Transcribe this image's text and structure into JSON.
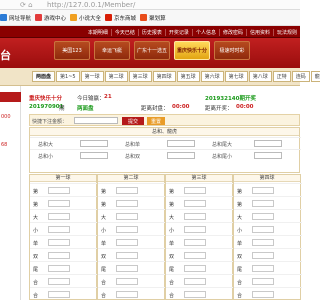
{
  "browser": {
    "url": "http://127.0.0.1/Member/",
    "bookmarks": [
      {
        "label": "网址导航",
        "color": "#2b7bd6"
      },
      {
        "label": "游戏中心",
        "color": "#e23b3b"
      },
      {
        "label": "小说大全",
        "color": "#f0a020"
      },
      {
        "label": "京东商城",
        "color": "#d81e06"
      },
      {
        "label": "聚划算",
        "color": "#e94d1b"
      }
    ]
  },
  "topbar": {
    "links": [
      "本期明细",
      "今天已结",
      "历史报表",
      "开奖记录",
      "个人信息",
      "修改密码",
      "信用资料",
      "玩法规则"
    ]
  },
  "header": {
    "logo": "台",
    "tabs": [
      {
        "label": "美国123",
        "active": false
      },
      {
        "label": "幸运飞艇",
        "active": false
      },
      {
        "label": "广东十一选五",
        "active": false
      },
      {
        "label": "重庆快乐十分",
        "active": true
      },
      {
        "label": "极速时时彩",
        "active": false
      }
    ]
  },
  "subnav": {
    "items": [
      "两面盘",
      "第1~5",
      "第一球",
      "第二球",
      "第三球",
      "第四球",
      "第五球",
      "第六球",
      "第七球",
      "第八球",
      "正特",
      "连码",
      "龍虎"
    ]
  },
  "sidebar": {
    "rows": [
      "000",
      "68"
    ]
  },
  "info": {
    "game": "重庆快乐十分",
    "today_pl_label": "今日输赢：",
    "today_pl_value": "21",
    "draw_period_right": "201932140期开奖",
    "period": "201970901",
    "period_suffix": "期",
    "mode": "两面盘",
    "close_label": "距离封盘：",
    "close_time": "00:00",
    "open_label": "距离开奖：",
    "open_time": "00:00"
  },
  "quick": {
    "label": "快捷下注金额：",
    "submit": "提交",
    "reset": "重置"
  },
  "combo": {
    "title": "总和、龍虎",
    "rows": [
      [
        "总和大",
        "总和单",
        "总和尾大"
      ],
      [
        "总和小",
        "总和双",
        "总和尾小"
      ]
    ]
  },
  "balls": {
    "tables": [
      {
        "title": "第一球",
        "keys": [
          "第",
          "第",
          "大",
          "小",
          "单",
          "双",
          "尾",
          "合",
          "合"
        ]
      },
      {
        "title": "第二球",
        "keys": [
          "第",
          "第",
          "大",
          "小",
          "单",
          "双",
          "尾",
          "合",
          "合"
        ]
      },
      {
        "title": "第三球",
        "keys": [
          "第",
          "第",
          "大",
          "小",
          "单",
          "双",
          "尾",
          "合",
          "合"
        ]
      },
      {
        "title": "第四球",
        "keys": [
          "第",
          "第",
          "大",
          "小",
          "单",
          "双",
          "尾",
          "合",
          "合"
        ]
      }
    ]
  }
}
